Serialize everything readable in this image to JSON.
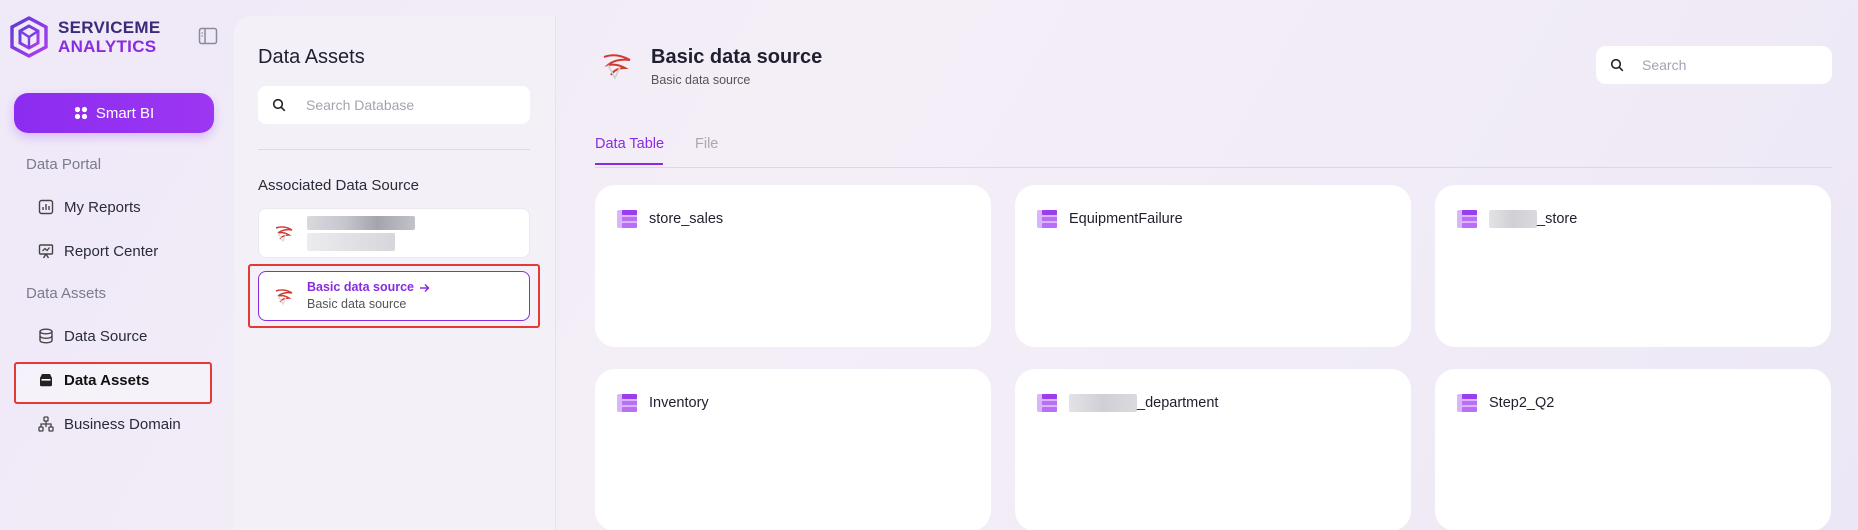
{
  "brand": {
    "line1": "SERVICEME",
    "line2": "ANALYTICS"
  },
  "sidebar": {
    "smart_bi_label": "Smart BI",
    "sections": [
      {
        "label": "Data Portal",
        "items": [
          {
            "label": "My Reports",
            "icon": "chart-report-icon"
          },
          {
            "label": "Report Center",
            "icon": "presentation-icon"
          }
        ]
      },
      {
        "label": "Data Assets",
        "items": [
          {
            "label": "Data Source",
            "icon": "database-icon"
          },
          {
            "label": "Data Assets",
            "icon": "inbox-icon",
            "active": true
          },
          {
            "label": "Business Domain",
            "icon": "hierarchy-icon"
          }
        ]
      }
    ]
  },
  "middle": {
    "title": "Data Assets",
    "search_placeholder": "Search Database",
    "associated_label": "Associated Data Source",
    "sources": [
      {
        "name": "",
        "subtitle": "",
        "redacted": true,
        "icon": "sql-server-icon"
      },
      {
        "name": "Basic data source",
        "subtitle": "Basic data source",
        "selected": true,
        "icon": "sql-server-icon"
      }
    ]
  },
  "main": {
    "title": "Basic data source",
    "subtitle": "Basic data source",
    "search_placeholder": "Search",
    "tabs": [
      {
        "label": "Data Table",
        "active": true
      },
      {
        "label": "File",
        "active": false
      }
    ],
    "tables": [
      {
        "name": "store_sales"
      },
      {
        "name": "EquipmentFailure"
      },
      {
        "name": "_store",
        "redacted_prefix": true
      },
      {
        "name": "Inventory"
      },
      {
        "name": "_department",
        "redacted_prefix": true
      },
      {
        "name": "Step2_Q2"
      }
    ]
  },
  "colors": {
    "accent": "#8a2be2",
    "highlight_outline": "#e53935",
    "table_icon": "#a24cf0"
  }
}
